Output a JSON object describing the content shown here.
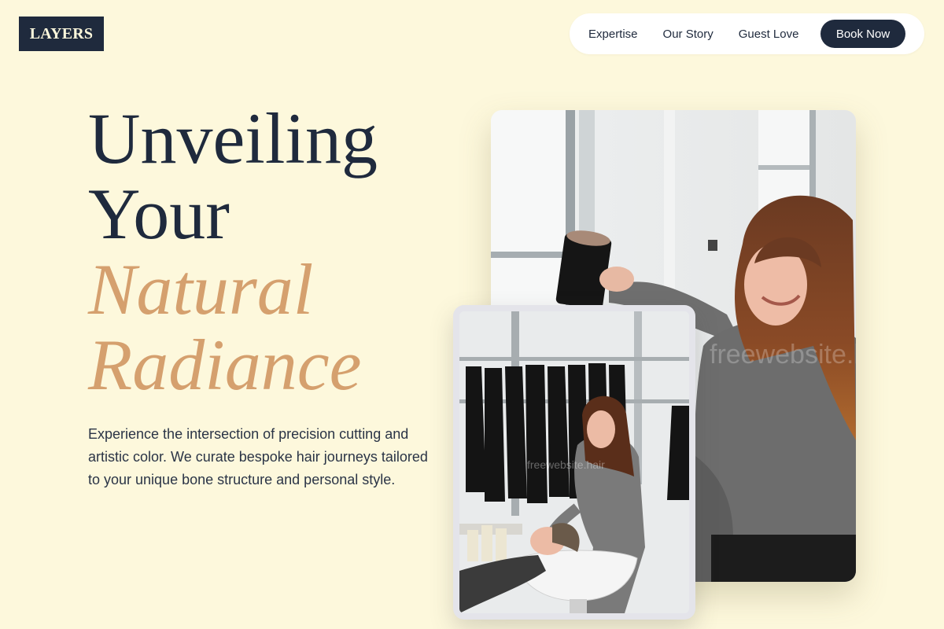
{
  "brand": {
    "logo_text": "LAYERS"
  },
  "nav": {
    "items": [
      {
        "label": "Expertise"
      },
      {
        "label": "Our Story"
      },
      {
        "label": "Guest Love"
      }
    ],
    "cta_label": "Book Now"
  },
  "hero": {
    "headline_line1": "Unveiling",
    "headline_line2": "Your",
    "headline_accent_line1": "Natural",
    "headline_accent_line2": "Radiance",
    "description": "Experience the intersection of precision cutting and artistic color. We curate bespoke hair journeys tailored to your unique bone structure and personal style."
  },
  "images": {
    "main_watermark": "freewebsite.hair",
    "small_watermark": "freewebsite.hair"
  },
  "colors": {
    "background": "#fdf8dc",
    "navy": "#1f2a3d",
    "accent_gold": "#d5a06e",
    "nav_bg": "#ffffff"
  }
}
